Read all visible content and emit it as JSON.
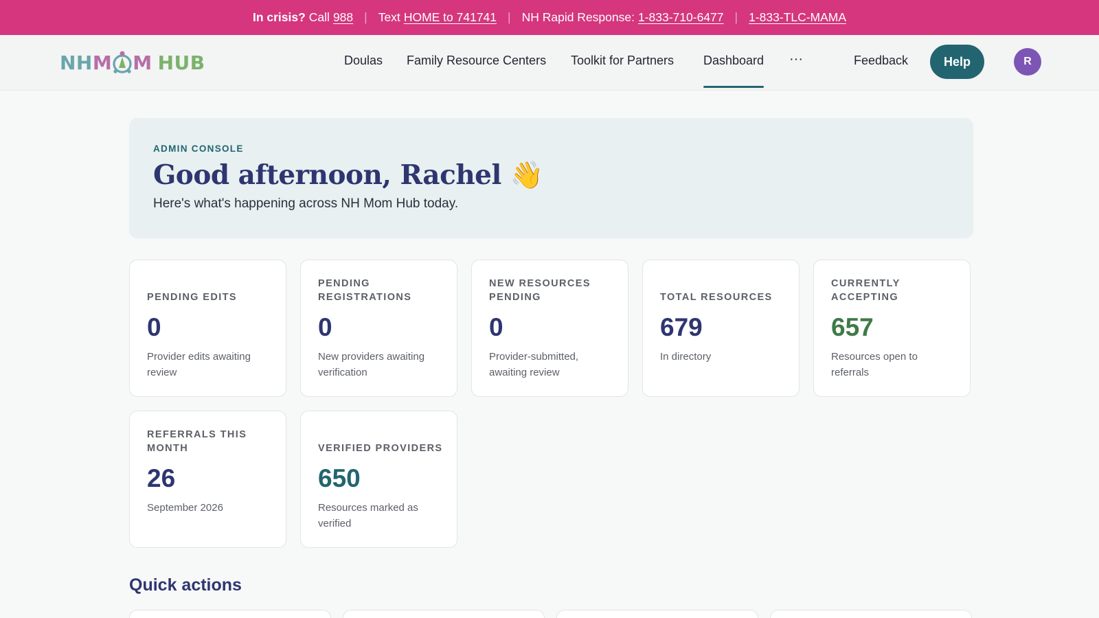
{
  "crisis_banner": {
    "crisis_label": "In crisis?",
    "call_label": "Call",
    "call_number": "988",
    "text_label": "Text",
    "text_link": "HOME to 741741",
    "rapid_label": "NH Rapid Response:",
    "rapid_number": "1-833-710-6477",
    "tlc_number": "1-833-TLC-MAMA",
    "separator": "|"
  },
  "header": {
    "logo": {
      "part1": "NH",
      "part2_a": "M",
      "part2_b": "M",
      "part3": "HUB"
    },
    "nav": [
      {
        "label": "Doulas"
      },
      {
        "label": "Family Resource Centers"
      },
      {
        "label": "Toolkit for Partners"
      },
      {
        "label": "Dashboard",
        "active": true
      }
    ],
    "more_icon": "more-horizontal-icon",
    "more_glyph": "···",
    "feedback_label": "Feedback",
    "help_label": "Help",
    "avatar_initial": "R"
  },
  "welcome": {
    "kicker": "ADMIN CONSOLE",
    "greeting": "Good afternoon, Rachel",
    "greeting_emoji": "👋",
    "subtitle": "Here's what's happening across NH Mom Hub today."
  },
  "stats": [
    {
      "label": "PENDING EDITS",
      "value": "0",
      "description": "Provider edits awaiting review",
      "color": "#2e3670"
    },
    {
      "label": "PENDING REGISTRATIONS",
      "value": "0",
      "description": "New providers awaiting verification",
      "color": "#2e3670"
    },
    {
      "label": "NEW RESOURCES PENDING",
      "value": "0",
      "description": "Provider-submitted, awaiting review",
      "color": "#2e3670"
    },
    {
      "label": "TOTAL RESOURCES",
      "value": "679",
      "description": "In directory",
      "color": "#2e3670"
    },
    {
      "label": "CURRENTLY ACCEPTING",
      "value": "657",
      "description": "Resources open to referrals",
      "color": "#3f7a47"
    },
    {
      "label": "REFERRALS THIS MONTH",
      "value": "26",
      "description": "September 2026",
      "color": "#2e3670"
    },
    {
      "label": "VERIFIED PROVIDERS",
      "value": "650",
      "description": "Resources marked as verified",
      "color": "#226570"
    }
  ],
  "quick_actions": {
    "title": "Quick actions"
  },
  "colors": {
    "banner": "#d5367d",
    "primary": "#226570",
    "heading": "#2e3670",
    "avatar": "#7d55b5",
    "accepting_green": "#3f7a47"
  }
}
